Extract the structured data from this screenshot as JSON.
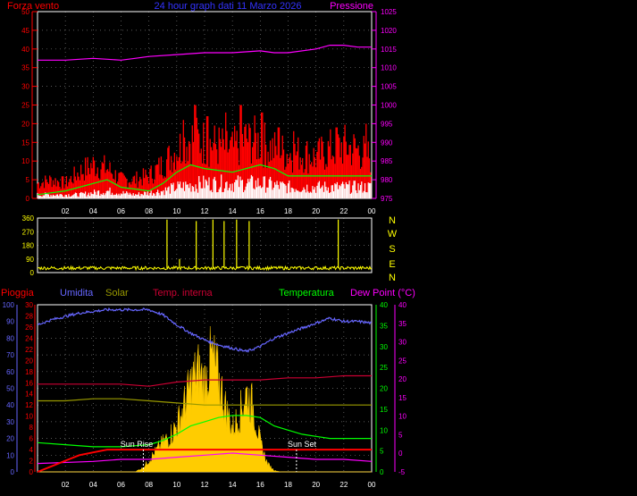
{
  "header": {
    "wind_label": "Forza vento",
    "title": "24 hour graph dati 11 Marzo 2026",
    "pressure_label": "Pressione"
  },
  "bottom_header": {
    "rain": "Pioggia",
    "humidity": "Umidita",
    "solar": "Solar",
    "temp_internal": "Temp. interna",
    "temperature": "Temperatura",
    "dew_point": "Dew Point (°C)"
  },
  "compass": [
    "N",
    "W",
    "S",
    "E",
    "N"
  ],
  "annotations": {
    "sun_rise": "Sun Rise",
    "sun_set": "Sun Set"
  },
  "colors": {
    "wind": "#ff0000",
    "gust_avg": "#00ff00",
    "wind_min": "#ffffff",
    "pressure": "#ff00ff",
    "direction": "#ffff00",
    "humidity": "#6666ff",
    "solar": "#ffcc00",
    "temp_internal": "#cc0033",
    "temp_internal_alt": "#999900",
    "temperature": "#00ff00",
    "dew_point": "#ff00ff",
    "rain": "#ff0000"
  },
  "chart_data": [
    {
      "type": "area",
      "name": "wind",
      "x_ticks": [
        "02",
        "04",
        "06",
        "08",
        "10",
        "12",
        "14",
        "16",
        "18",
        "20",
        "22",
        "00"
      ],
      "y_left_ticks": [
        0,
        5,
        10,
        15,
        20,
        25,
        30,
        35,
        40,
        45,
        50
      ],
      "y_left_range": [
        0,
        50
      ],
      "y_right_ticks": [
        975,
        980,
        985,
        990,
        995,
        1000,
        1005,
        1010,
        1015,
        1020,
        1025
      ],
      "y_right_range": [
        975,
        1025
      ],
      "x_range_hours": [
        0,
        24
      ],
      "wind_speed": [
        [
          0,
          4
        ],
        [
          1,
          5
        ],
        [
          2,
          4
        ],
        [
          3,
          7
        ],
        [
          4,
          9
        ],
        [
          5,
          8
        ],
        [
          6,
          5
        ],
        [
          7,
          5
        ],
        [
          8,
          6
        ],
        [
          9,
          9
        ],
        [
          10,
          13
        ],
        [
          11,
          16
        ],
        [
          12,
          15
        ],
        [
          13,
          14
        ],
        [
          14,
          13
        ],
        [
          15,
          16
        ],
        [
          16,
          15
        ],
        [
          17,
          13
        ],
        [
          18,
          12
        ],
        [
          19,
          12
        ],
        [
          20,
          11
        ],
        [
          21,
          13
        ],
        [
          22,
          14
        ],
        [
          23,
          13
        ],
        [
          24,
          11
        ]
      ],
      "wind_peaks": [
        [
          10.5,
          21
        ],
        [
          11.3,
          25
        ],
        [
          12.2,
          22
        ],
        [
          13.5,
          23
        ],
        [
          14.6,
          25
        ],
        [
          15.2,
          20
        ],
        [
          16.1,
          23
        ],
        [
          17.3,
          19
        ],
        [
          18.4,
          18
        ],
        [
          21.5,
          19
        ],
        [
          23.6,
          20
        ]
      ],
      "gust_avg": [
        [
          0,
          1
        ],
        [
          2,
          2
        ],
        [
          4,
          4
        ],
        [
          5,
          5
        ],
        [
          6,
          3
        ],
        [
          8,
          2
        ],
        [
          9,
          4
        ],
        [
          10,
          7
        ],
        [
          11,
          9
        ],
        [
          12,
          8
        ],
        [
          14,
          7
        ],
        [
          16,
          9
        ],
        [
          17,
          8
        ],
        [
          18,
          6
        ],
        [
          20,
          6
        ],
        [
          22,
          6
        ],
        [
          24,
          6
        ]
      ],
      "wind_min": [
        [
          0,
          1
        ],
        [
          3,
          1
        ],
        [
          5,
          2
        ],
        [
          7,
          1
        ],
        [
          9,
          2
        ],
        [
          10,
          3
        ],
        [
          12,
          4
        ],
        [
          14,
          4
        ],
        [
          16,
          4
        ],
        [
          18,
          3
        ],
        [
          20,
          3
        ],
        [
          22,
          3
        ],
        [
          24,
          3
        ]
      ],
      "pressure": [
        [
          0,
          1012
        ],
        [
          2,
          1012
        ],
        [
          4,
          1012.5
        ],
        [
          6,
          1012
        ],
        [
          7,
          1012.5
        ],
        [
          8,
          1013
        ],
        [
          10,
          1013.5
        ],
        [
          12,
          1014
        ],
        [
          14,
          1014
        ],
        [
          16,
          1014.5
        ],
        [
          17,
          1014
        ],
        [
          18,
          1014
        ],
        [
          20,
          1015
        ],
        [
          21,
          1016
        ],
        [
          22,
          1016
        ],
        [
          23,
          1015.5
        ],
        [
          24,
          1015.5
        ]
      ]
    },
    {
      "type": "line",
      "name": "wind_direction",
      "y_left_ticks": [
        0,
        90,
        180,
        270,
        360
      ],
      "y_range": [
        0,
        360
      ],
      "baseline": 30,
      "spikes": [
        [
          9.3,
          350
        ],
        [
          10.2,
          90
        ],
        [
          11.4,
          340
        ],
        [
          12.6,
          350
        ],
        [
          13.4,
          340
        ],
        [
          14.3,
          350
        ],
        [
          15.2,
          340
        ],
        [
          21.6,
          350
        ]
      ]
    },
    {
      "type": "line",
      "name": "environment",
      "x_ticks": [
        "02",
        "04",
        "06",
        "08",
        "10",
        "12",
        "14",
        "16",
        "18",
        "20",
        "22",
        "00"
      ],
      "rain_ticks": [
        0,
        2,
        4,
        6,
        8,
        10,
        12,
        14,
        16,
        18,
        20,
        22,
        24,
        26,
        28,
        30
      ],
      "humidity_ticks": [
        0,
        10,
        20,
        30,
        40,
        50,
        60,
        70,
        80,
        90,
        100
      ],
      "temp_ticks": [
        0,
        5,
        10,
        15,
        20,
        25,
        30,
        35,
        40
      ],
      "dew_ticks": [
        -5,
        0,
        5,
        10,
        15,
        20,
        25,
        30,
        35,
        40
      ],
      "humidity": [
        [
          0,
          88
        ],
        [
          1,
          91
        ],
        [
          2,
          93
        ],
        [
          3,
          95
        ],
        [
          4,
          96
        ],
        [
          5,
          97
        ],
        [
          6,
          97
        ],
        [
          7,
          97
        ],
        [
          8,
          97
        ],
        [
          9,
          94
        ],
        [
          10,
          88
        ],
        [
          11,
          83
        ],
        [
          12,
          79
        ],
        [
          13,
          76
        ],
        [
          14,
          74
        ],
        [
          15,
          72
        ],
        [
          16,
          75
        ],
        [
          17,
          80
        ],
        [
          18,
          83
        ],
        [
          19,
          86
        ],
        [
          20,
          89
        ],
        [
          21,
          92
        ],
        [
          22,
          90
        ],
        [
          23,
          90
        ],
        [
          24,
          89
        ]
      ],
      "solar": [
        [
          0,
          0
        ],
        [
          7,
          0
        ],
        [
          7.6,
          3
        ],
        [
          8,
          8
        ],
        [
          8.5,
          14
        ],
        [
          9,
          20
        ],
        [
          9.5,
          25
        ],
        [
          10,
          32
        ],
        [
          10.5,
          45
        ],
        [
          11,
          60
        ],
        [
          11.5,
          70
        ],
        [
          12,
          62
        ],
        [
          12.5,
          80
        ],
        [
          13,
          65
        ],
        [
          13.5,
          45
        ],
        [
          14,
          30
        ],
        [
          14.5,
          40
        ],
        [
          15,
          55
        ],
        [
          15.5,
          45
        ],
        [
          16,
          20
        ],
        [
          16.5,
          6
        ],
        [
          17,
          1
        ],
        [
          17.5,
          0
        ],
        [
          24,
          0
        ]
      ],
      "temp_internal": [
        [
          0,
          21
        ],
        [
          2,
          21
        ],
        [
          4,
          21
        ],
        [
          6,
          21
        ],
        [
          8,
          20.5
        ],
        [
          9,
          21
        ],
        [
          10,
          21.5
        ],
        [
          12,
          22
        ],
        [
          14,
          22
        ],
        [
          16,
          22
        ],
        [
          18,
          22.5
        ],
        [
          20,
          22.5
        ],
        [
          22,
          23
        ],
        [
          24,
          23
        ]
      ],
      "temp_internal_alt": [
        [
          0,
          17
        ],
        [
          2,
          17
        ],
        [
          4,
          17.5
        ],
        [
          6,
          17.5
        ],
        [
          8,
          17
        ],
        [
          10,
          16.5
        ],
        [
          12,
          16
        ],
        [
          14,
          16
        ],
        [
          16,
          16
        ],
        [
          18,
          16
        ],
        [
          20,
          16
        ],
        [
          22,
          16
        ],
        [
          24,
          16
        ]
      ],
      "temperature": [
        [
          0,
          7
        ],
        [
          2,
          6.5
        ],
        [
          4,
          6
        ],
        [
          6,
          6
        ],
        [
          8,
          6.5
        ],
        [
          9,
          7.5
        ],
        [
          10,
          9
        ],
        [
          11,
          11
        ],
        [
          12,
          12
        ],
        [
          13,
          13
        ],
        [
          14,
          13.5
        ],
        [
          15,
          13.5
        ],
        [
          16,
          13
        ],
        [
          17,
          11
        ],
        [
          18,
          10
        ],
        [
          19,
          9
        ],
        [
          20,
          8.5
        ],
        [
          21,
          8
        ],
        [
          22,
          8
        ],
        [
          23,
          8
        ],
        [
          24,
          8
        ]
      ],
      "dew_point": [
        [
          0,
          2
        ],
        [
          4,
          2.5
        ],
        [
          6,
          3
        ],
        [
          8,
          3
        ],
        [
          10,
          3.5
        ],
        [
          12,
          4
        ],
        [
          14,
          4.5
        ],
        [
          16,
          4
        ],
        [
          18,
          3.5
        ],
        [
          20,
          3
        ],
        [
          22,
          3
        ],
        [
          24,
          2.5
        ]
      ],
      "rain": [
        [
          0,
          0
        ],
        [
          1,
          1
        ],
        [
          2,
          2
        ],
        [
          3,
          3
        ],
        [
          4,
          3.5
        ],
        [
          5,
          4
        ],
        [
          24,
          4
        ]
      ]
    }
  ]
}
